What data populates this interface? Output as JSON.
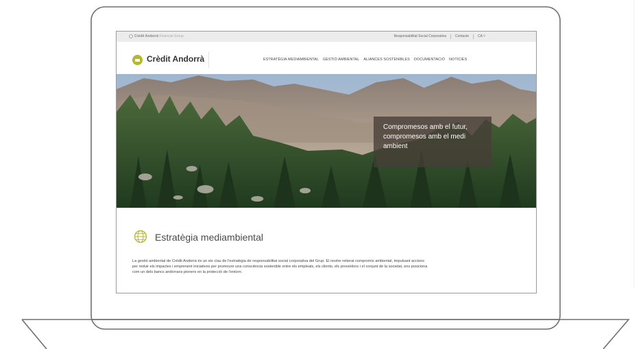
{
  "topbar": {
    "group_brand": "Crèdit Andorrà",
    "group_suffix": "Financial Group",
    "links": [
      "Responsabilitat Social Corporativa",
      "Contacte",
      "CA ˅"
    ]
  },
  "header": {
    "brand": "Crèdit Andorrà",
    "nav": [
      "ESTRATÈGIA MEDIAMBIENTAL",
      "GESTIÓ AMBIENTAL",
      "ALIANCES SOSTENIBLES",
      "DOCUMENTACIÓ",
      "NOTÍCIES"
    ]
  },
  "hero": {
    "caption": "Compromesos amb el futur, compromesos amb el medi ambient"
  },
  "section": {
    "icon": "globe-icon",
    "title": "Estratègia mediambiental",
    "body": "La gestió ambiental de Crèdit Andorrà és un eix clau de l'estratègia de responsabilitat social corporativa del Grup. El nostre reiterat compromís ambiental, impulsant accions per reduir els impactes i emprenent iniciatives per promoure una consciència sostenible entre els empleats, els clients, els proveïdors i el conjunt de la societat, ens posiciona com un dels bancs andorrans pioners en la protecció de l'entorn."
  },
  "colors": {
    "brand": "#b4b82a",
    "caption_bg": "#463e37",
    "frame": "#6f6f6f"
  }
}
